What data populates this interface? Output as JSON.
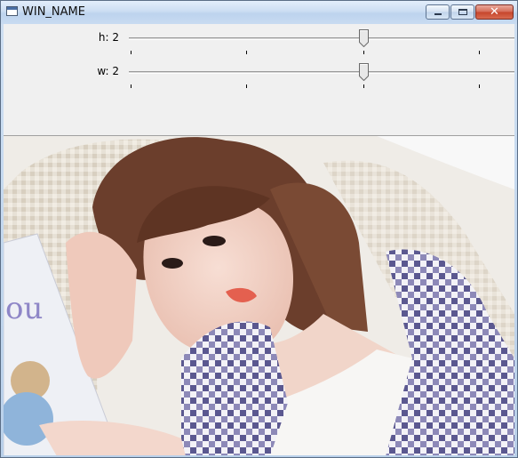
{
  "window": {
    "title": "WIN_NAME"
  },
  "trackbars": [
    {
      "label": "h: 2",
      "value": 2
    },
    {
      "label": "w: 2",
      "value": 2
    }
  ],
  "image": {
    "description": "photo"
  }
}
